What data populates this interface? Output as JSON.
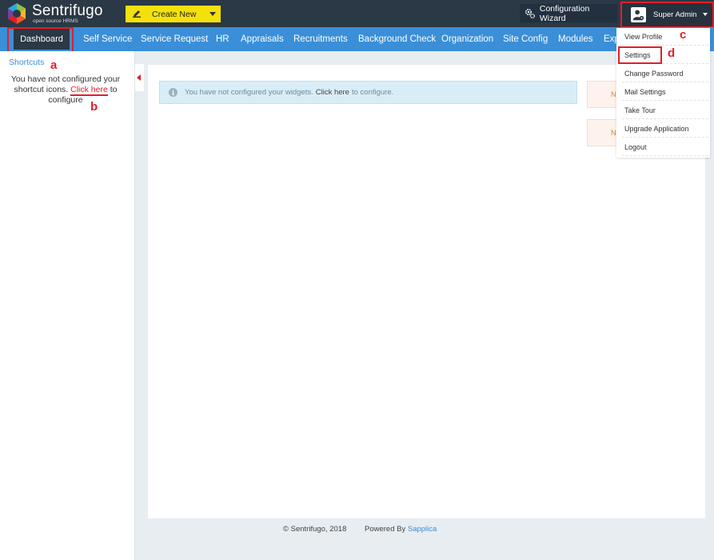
{
  "header": {
    "logo_name": "Sentrifugo",
    "logo_tagline": "open source HRMS",
    "create_new_label": "Create New",
    "config_wizard_label": "Configuration Wizard",
    "user_name": "Super Admin"
  },
  "nav": {
    "items": [
      "Dashboard",
      "Self Service",
      "Service Request",
      "HR",
      "Appraisals",
      "Recruitments",
      "Background Check",
      "Organization",
      "Site Config",
      "Modules",
      "Exp"
    ]
  },
  "sidebar": {
    "title": "Shortcuts",
    "message_before": "You have not configured your shortcut icons.",
    "link_text": "Click here",
    "message_after": "to configure"
  },
  "main": {
    "alert_before": "You have not configured your widgets.",
    "alert_link": "Click here",
    "alert_after": "to configure.",
    "widget_1_text": "N",
    "widget_2_text": "N"
  },
  "footer": {
    "copyright": "© Sentrifugo, 2018",
    "powered_by": "Powered By",
    "vendor": "Sapplica"
  },
  "user_dropdown": {
    "items": [
      "View Profile",
      "Settings",
      "Change Password",
      "Mail Settings",
      "Take Tour",
      "Upgrade Application",
      "Logout"
    ]
  },
  "annotations": {
    "a": "a",
    "b": "b",
    "c": "c",
    "d": "d"
  },
  "colors": {
    "nav_blue": "#3a8fd8",
    "topbar": "#2b3845",
    "create_new_yellow": "#f5e10a",
    "annotation_red": "#e21f26"
  }
}
